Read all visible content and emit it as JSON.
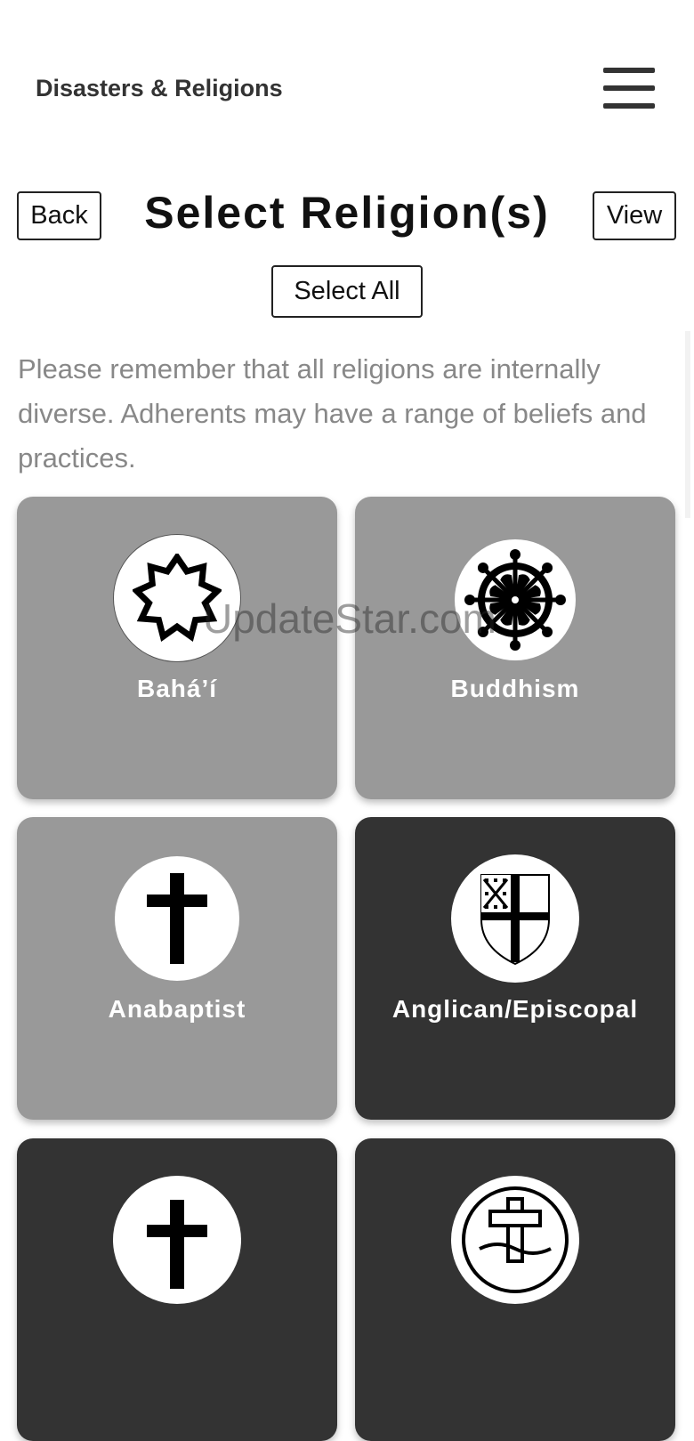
{
  "header": {
    "title": "Disasters & Religions",
    "menu_icon": "hamburger-menu-icon"
  },
  "toolbar": {
    "back_label": "Back",
    "title": "Select Religion(s)",
    "view_label": "View",
    "select_all_label": "Select All"
  },
  "notice": "Please remember that all religions are internally diverse. Adherents may have a range of beliefs and practices.",
  "watermark": "UpdateStar.com",
  "colors": {
    "selected": "#333333",
    "unselected": "#999999",
    "label": "#ffffff"
  },
  "religions": [
    {
      "label": "Bahá’í",
      "icon": "nine-pointed-star-icon",
      "selected": false
    },
    {
      "label": "Buddhism",
      "icon": "dharma-wheel-icon",
      "selected": false
    },
    {
      "label": "Anabaptist",
      "icon": "latin-cross-icon",
      "selected": false
    },
    {
      "label": "Anglican/Episcopal",
      "icon": "episcopal-shield-icon",
      "selected": true
    },
    {
      "label": "",
      "icon": "cross-icon",
      "selected": true
    },
    {
      "label": "",
      "icon": "cross-seal-icon",
      "selected": true
    }
  ]
}
